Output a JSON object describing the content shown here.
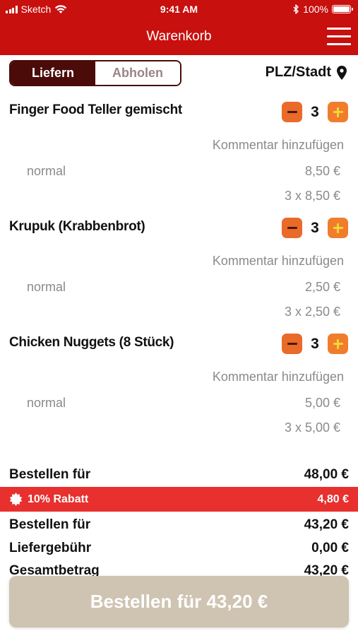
{
  "status_bar": {
    "carrier": "Sketch",
    "time": "9:41 AM",
    "battery": "100%"
  },
  "nav": {
    "title": "Warenkorb",
    "menu_icon": "hamburger-icon"
  },
  "delivery_toggle": {
    "options": [
      "Liefern",
      "Abholen"
    ],
    "selected": "Liefern"
  },
  "location": {
    "label": "PLZ/Stadt",
    "icon": "location-pin-icon"
  },
  "items": [
    {
      "name": "Finger Food Teller gemischt",
      "quantity": "3",
      "comment_link": "Kommentar hinzufügen",
      "variant": "normal",
      "unit_price": "8,50 €",
      "line_total": "3 x 8,50 €"
    },
    {
      "name": "Krupuk (Krabbenbrot)",
      "quantity": "3",
      "comment_link": "Kommentar hinzufügen",
      "variant": "normal",
      "unit_price": "2,50 €",
      "line_total": "3 x 2,50 €"
    },
    {
      "name": "Chicken Nuggets (8 Stück)",
      "quantity": "3",
      "comment_link": "Kommentar hinzufügen",
      "variant": "normal",
      "unit_price": "5,00 €",
      "line_total": "3 x 5,00 €"
    }
  ],
  "summary": {
    "subtotal_label": "Bestellen für",
    "subtotal_value": "48,00 €",
    "discount_label": "10% Rabatt",
    "discount_value": "4,80 €",
    "after_discount_label": "Bestellen für",
    "after_discount_value": "43,20 €",
    "delivery_fee_label": "Liefergebühr",
    "delivery_fee_value": "0,00 €",
    "total_label": "Gesamtbetrag",
    "total_value": "43,20 €"
  },
  "order_button": {
    "label": "Bestellen für 43,20 €"
  },
  "colors": {
    "brand_red": "#c8100e",
    "toggle_dark": "#4a0b09",
    "stepper_orange": "#ea6a2a",
    "discount_red": "#e8302e",
    "order_button": "#cfc3b2"
  }
}
